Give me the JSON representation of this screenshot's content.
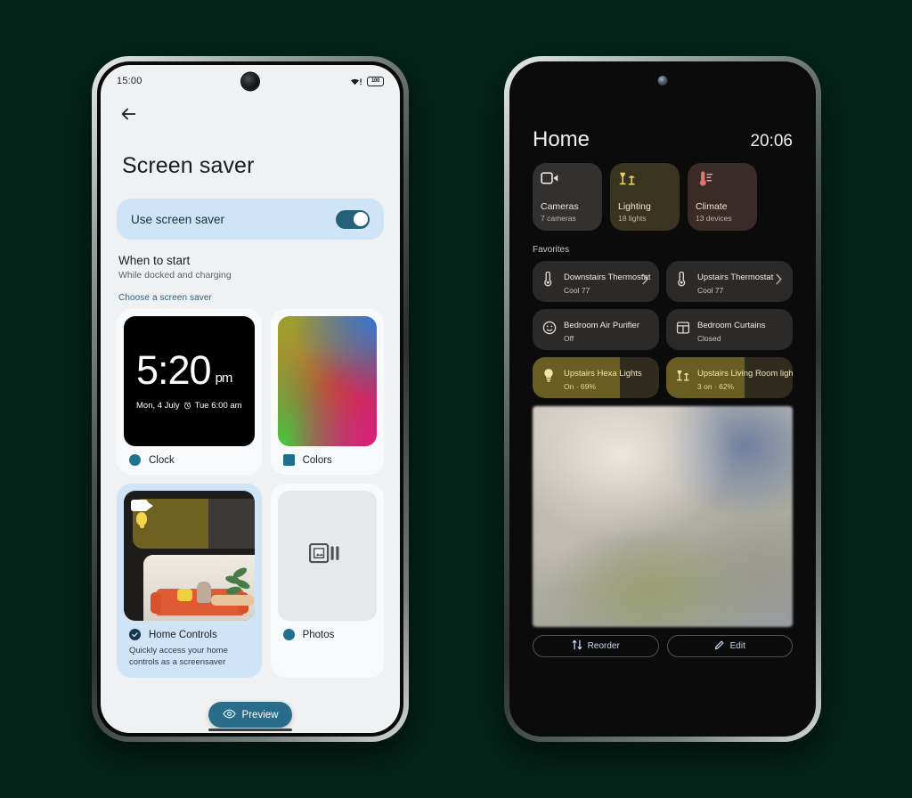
{
  "background_color": "#042319",
  "left_phone": {
    "status_bar": {
      "time": "15:00",
      "wifi_icon": "wifi-alert-icon",
      "battery_text": "100"
    },
    "nav": {
      "back_icon": "back-arrow-icon"
    },
    "page_title": "Screen saver",
    "use_screen_saver": {
      "label": "Use screen saver",
      "enabled": true
    },
    "when_to_start": {
      "title": "When to start",
      "subtitle": "While docked and charging"
    },
    "choose_label": "Choose a screen saver",
    "options": [
      {
        "name": "Clock",
        "selected": false,
        "marker": "radio-circle",
        "preview": {
          "type": "clock",
          "time": "5:20",
          "ampm": "pm",
          "date": "Mon, 4 July",
          "alarm_icon": "alarm-clock-icon",
          "alarm": "Tue 6:00 am"
        }
      },
      {
        "name": "Colors",
        "selected": false,
        "marker": "radio-square",
        "preview": {
          "type": "gradient"
        }
      },
      {
        "name": "Home Controls",
        "selected": true,
        "marker": "radio-check",
        "description": "Quickly access your home controls as a screensaver",
        "preview": {
          "type": "home-controls",
          "light_icon": "lightbulb-icon",
          "camera_icon": "video-camera-icon"
        }
      },
      {
        "name": "Photos",
        "selected": false,
        "marker": "radio-circle",
        "preview": {
          "type": "photos",
          "icon": "photo-stack-icon"
        }
      }
    ],
    "preview_button": {
      "label": "Preview",
      "icon": "eye-icon",
      "color": "#2a6d8a"
    }
  },
  "right_phone": {
    "app_title": "Home",
    "clock": "20:06",
    "tiles": [
      {
        "name": "Cameras",
        "subtitle": "7 cameras",
        "icon": "video-camera-icon",
        "tint": "#33312f"
      },
      {
        "name": "Lighting",
        "subtitle": "18 lights",
        "icon": "lamps-icon",
        "tint": "#39341f"
      },
      {
        "name": "Climate",
        "subtitle": "13 devices",
        "icon": "thermometer-icon",
        "tint": "#3a2b29"
      }
    ],
    "favorites_label": "Favorites",
    "favorites": [
      {
        "name": "Downstairs Thermostat",
        "status": "Cool 77",
        "icon": "thermostat-icon",
        "chevron": true,
        "lit": false,
        "fill_percent": 0
      },
      {
        "name": "Upstairs Thermostat",
        "status": "Cool 77",
        "icon": "thermostat-icon",
        "chevron": true,
        "lit": false,
        "fill_percent": 0
      },
      {
        "name": "Bedroom Air Purifier",
        "status": "Off",
        "icon": "air-purifier-icon",
        "chevron": false,
        "lit": false,
        "fill_percent": 0
      },
      {
        "name": "Bedroom Curtains",
        "status": "Closed",
        "icon": "curtains-icon",
        "chevron": false,
        "lit": false,
        "fill_percent": 0
      },
      {
        "name": "Upstairs Hexa Lights",
        "status": "On · 69%",
        "icon": "lightbulb-icon",
        "chevron": false,
        "lit": true,
        "fill_percent": 69
      },
      {
        "name": "Upstairs Living Room lights",
        "status": "3 on · 62%",
        "icon": "lamps-icon",
        "chevron": false,
        "lit": true,
        "fill_percent": 62
      }
    ],
    "camera_feed": {
      "name": "camera-live-feed",
      "blurred": true
    },
    "buttons": [
      {
        "label": "Reorder",
        "icon": "reorder-icon"
      },
      {
        "label": "Edit",
        "icon": "pencil-icon"
      }
    ]
  }
}
